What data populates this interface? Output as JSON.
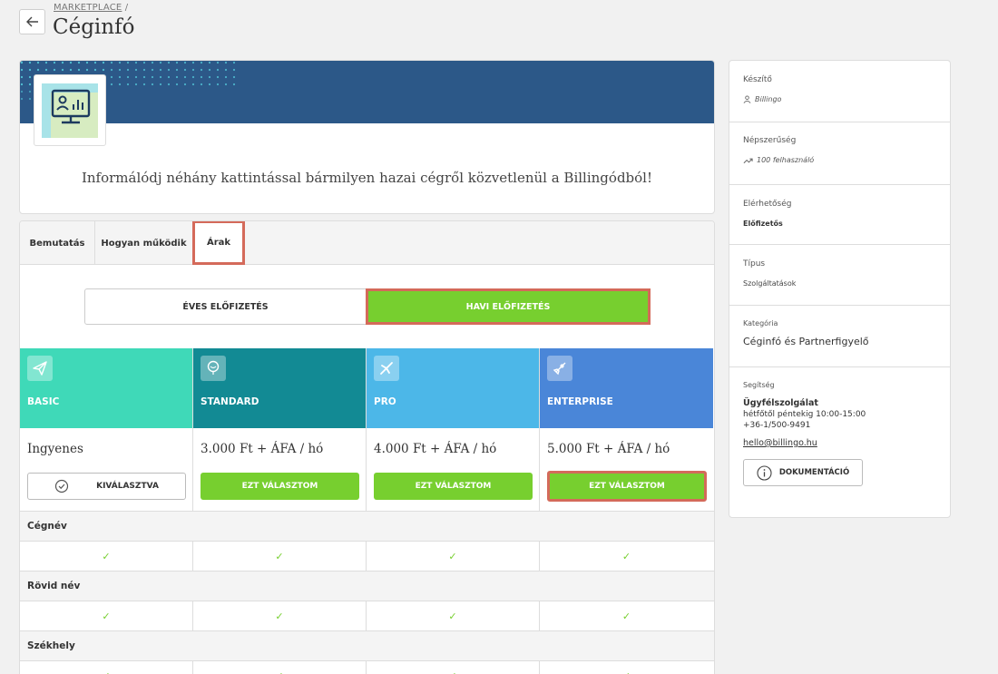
{
  "header": {
    "breadcrumb": "MARKETPLACE",
    "breadcrumb_sep": "/",
    "title": "Céginfó"
  },
  "hero": {
    "tagline": "Informálódj néhány kattintással bármilyen hazai cégről közvetlenül a Billingódból!"
  },
  "tabs": [
    {
      "label": "Bemutatás"
    },
    {
      "label": "Hogyan működik"
    },
    {
      "label": "Árak"
    }
  ],
  "billing_toggle": {
    "yearly": "ÉVES ELŐFIZETÉS",
    "monthly": "HAVI ELŐFIZETÉS",
    "selected": "monthly"
  },
  "plans": [
    {
      "name": "BASIC",
      "price": "Ingyenes",
      "button": "KIVÁLASZTVA",
      "color": "#3fd9b8",
      "icon": "paper-plane-icon"
    },
    {
      "name": "STANDARD",
      "price": "3.000 Ft + ÁFA / hó",
      "button": "EZT VÁLASZTOM",
      "color": "#128a94",
      "icon": "balloon-icon"
    },
    {
      "name": "PRO",
      "price": "4.000 Ft + ÁFA / hó",
      "button": "EZT VÁLASZTOM",
      "color": "#4cb7e8",
      "icon": "airplane-icon"
    },
    {
      "name": "ENTERPRISE",
      "price": "5.000 Ft + ÁFA / hó",
      "button": "EZT VÁLASZTOM",
      "color": "#4a86d8",
      "icon": "rocket-icon"
    }
  ],
  "features": [
    {
      "label": "Cégnév",
      "values": [
        "✓",
        "✓",
        "✓",
        "✓"
      ]
    },
    {
      "label": "Rövid név",
      "values": [
        "✓",
        "✓",
        "✓",
        "✓"
      ]
    },
    {
      "label": "Székhely",
      "values": [
        "✓",
        "✓",
        "✓",
        "✓"
      ]
    }
  ],
  "sidebar": {
    "creator_label": "Készítő",
    "creator_value": "Billingo",
    "popularity_label": "Népszerűség",
    "popularity_value": "100 felhasználó",
    "availability_label": "Elérhetőség",
    "availability_value": "Előfizetős",
    "type_label": "Típus",
    "type_value": "Szolgáltatások",
    "category_label": "Kategória",
    "category_value": "Céginfó és Partnerfigyelő",
    "help_label": "Segítség",
    "help_title": "Ügyfélszolgálat",
    "help_hours": "hétfőtől péntekig 10:00-15:00",
    "help_phone": "+36-1/500-9491",
    "help_email": "hello@billingo.hu",
    "doc_button": "DOKUMENTÁCIÓ"
  },
  "colors": {
    "accent_green": "#77cf2f",
    "highlight_red": "#d46a5a",
    "banner_blue": "#2c5888"
  }
}
